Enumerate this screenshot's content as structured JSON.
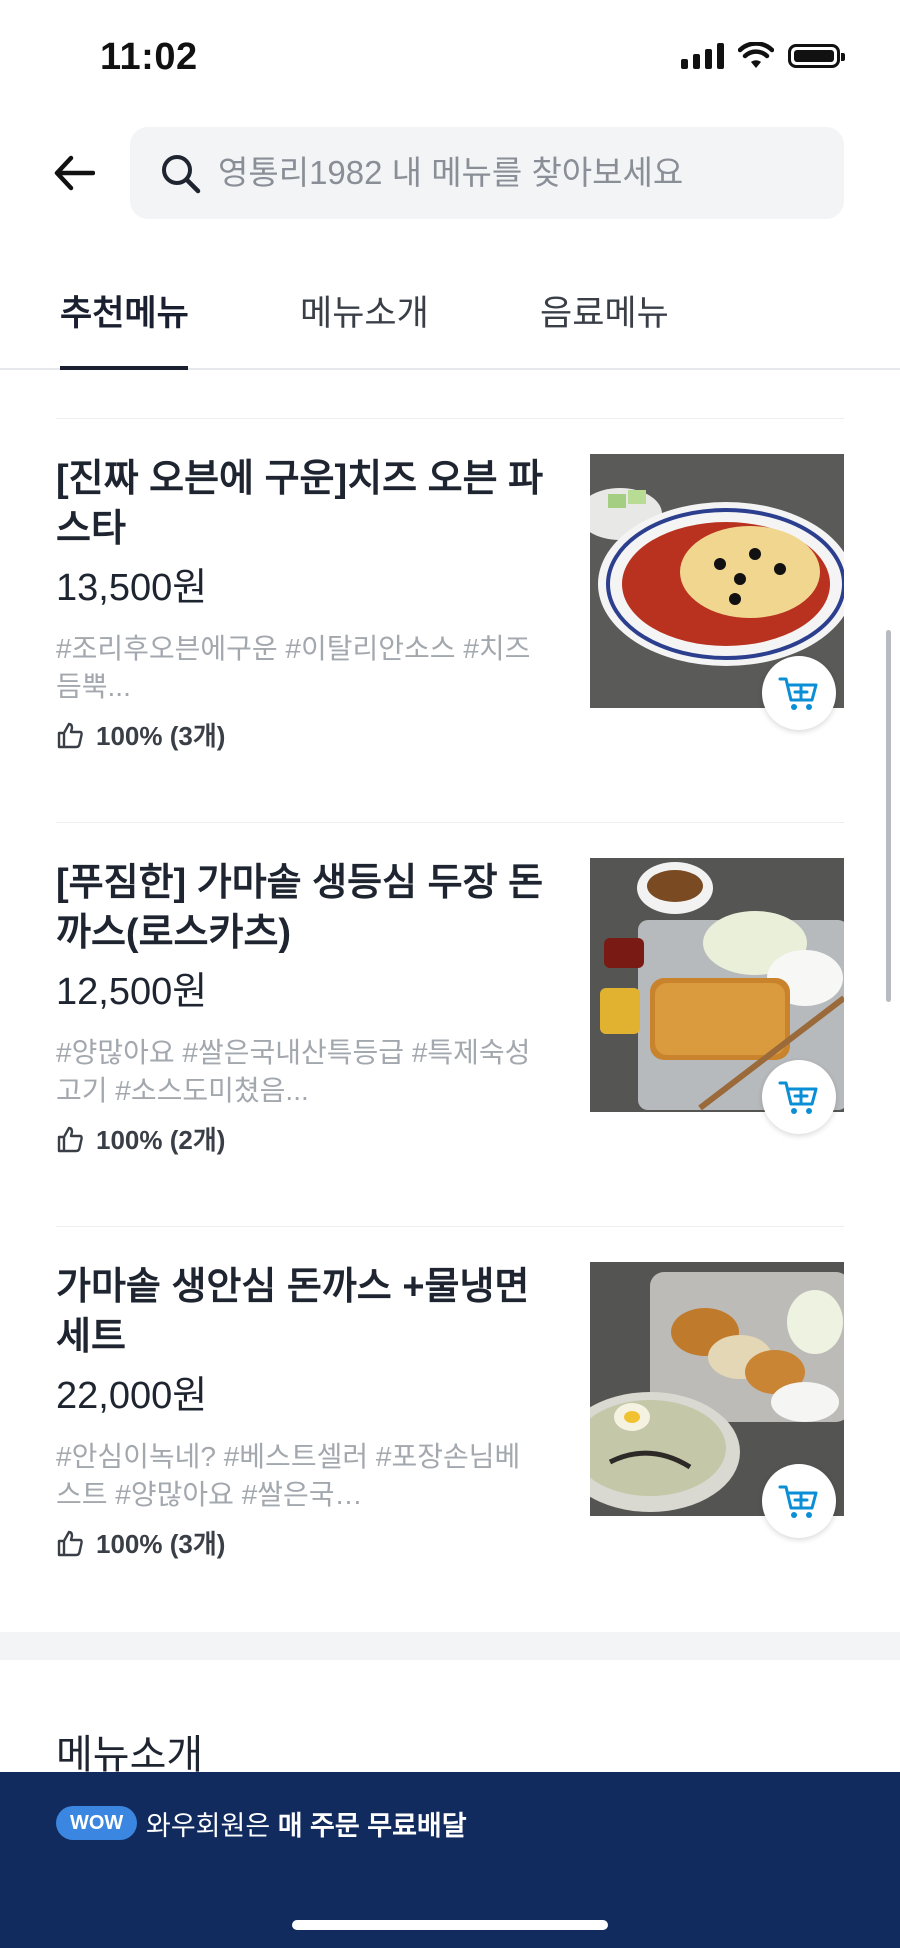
{
  "status_bar": {
    "time": "11:02"
  },
  "search": {
    "placeholder": "영통리1982 내 메뉴를 찾아보세요"
  },
  "tabs": [
    {
      "label": "추천메뉴",
      "active": true
    },
    {
      "label": "메뉴소개",
      "active": false
    },
    {
      "label": "음료메뉴",
      "active": false
    }
  ],
  "menu_items": [
    {
      "name": "[진짜 오븐에 구운]치즈 오븐 파스타",
      "price": "13,500원",
      "tags": "#조리후오븐에구운 #이탈리안소스 #치즈듬뿍...",
      "rating": "100% (3개)"
    },
    {
      "name": "[푸짐한] 가마솥 생등심 두장 돈까스(로스카츠)",
      "price": "12,500원",
      "tags": "#양많아요 #쌀은국내산특등급 #특제숙성고기 #소스도미쳤음...",
      "rating": "100% (2개)"
    },
    {
      "name": "가마솥 생안심 돈까스 +물냉면 세트",
      "price": "22,000원",
      "tags": "#안심이녹네? #베스트셀러 #포장손님베스트 #양많아요 #쌀은국…",
      "rating": "100% (3개)"
    }
  ],
  "section": {
    "title": "메뉴소개"
  },
  "wow_banner": {
    "badge": "WOW",
    "text_prefix": "와우회원은 ",
    "text_bold": "매 주문 무료배달"
  },
  "colors": {
    "accent": "#0a8fd6",
    "banner_bg": "#112b5f",
    "wow_badge": "#3b86e0"
  }
}
